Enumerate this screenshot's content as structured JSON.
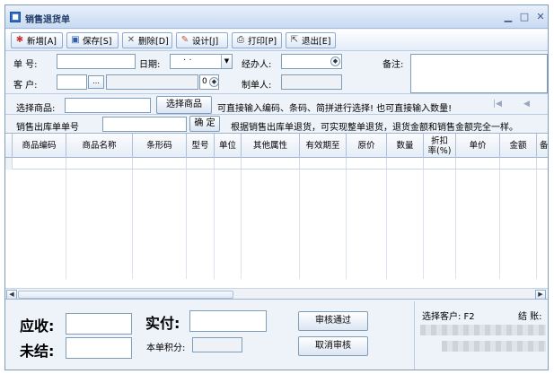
{
  "window": {
    "title": "销售退货单"
  },
  "toolbar": {
    "buttons": [
      {
        "label": "新增[A]",
        "icon": "new-icon"
      },
      {
        "label": "保存[S]",
        "icon": "save-icon"
      },
      {
        "label": "删除[D]",
        "icon": "delete-icon"
      },
      {
        "label": "设计[J]",
        "icon": "design-icon"
      },
      {
        "label": "打印[P]",
        "icon": "print-icon"
      },
      {
        "label": "退出[E]",
        "icon": "exit-icon"
      }
    ]
  },
  "header": {
    "order_no_label": "单  号:",
    "date_label": "日期:",
    "date_value": "·  ·",
    "handler_label": "经办人:",
    "remark_label": "备注:",
    "customer_label": "客  户:",
    "customer_browse": "...",
    "customer_num": "0",
    "maker_label": "制单人:"
  },
  "select_row": {
    "label": "选择商品:",
    "button": "选择商品",
    "hint": "可直接输入编码、条码、简拼进行选择! 也可直接输入数量!"
  },
  "outbound_row": {
    "label": "销售出库单单号",
    "confirm": "确 定",
    "hint": "根据销售出库单退货，可实现整单退货，退货金额和销售金额完全一样。"
  },
  "grid": {
    "columns": [
      "商品编码",
      "商品名称",
      "条形码",
      "型号",
      "单位",
      "其他属性",
      "有效期至",
      "原价",
      "数量",
      "折扣率(%)",
      "单价",
      "金额",
      "备"
    ]
  },
  "footer": {
    "receivable_label": "应收:",
    "paid_label": "实付:",
    "unsettled_label": "未结:",
    "points_label": "本单积分:",
    "approve_button": "审核通过",
    "cancel_approve_button": "取消审核",
    "info_select_customer": "选择客户: F2",
    "info_settle": "结 账:"
  },
  "colors": {
    "accent": "#2f6fc8",
    "border": "#7f9db9",
    "background": "#eef3fa"
  }
}
